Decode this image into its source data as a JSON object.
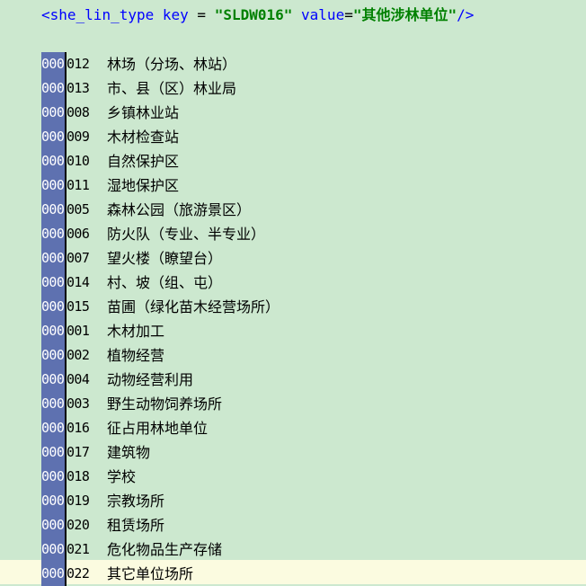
{
  "header": {
    "open_bracket": "<",
    "tag": "she_lin_type",
    "key_attr": "key",
    "key_eq": " = ",
    "key_value": "\"SLDW016\"",
    "value_attr": "value",
    "value_eq": "=",
    "value_value": "\"其他涉林单位\"",
    "close": "/>"
  },
  "items": [
    {
      "prefix": "000",
      "suffix": "012",
      "name": "林场（分场、林站）"
    },
    {
      "prefix": "000",
      "suffix": "013",
      "name": "市、县（区）林业局"
    },
    {
      "prefix": "000",
      "suffix": "008",
      "name": "乡镇林业站"
    },
    {
      "prefix": "000",
      "suffix": "009",
      "name": "木材检查站"
    },
    {
      "prefix": "000",
      "suffix": "010",
      "name": "自然保护区"
    },
    {
      "prefix": "000",
      "suffix": "011",
      "name": "湿地保护区"
    },
    {
      "prefix": "000",
      "suffix": "005",
      "name": "森林公园（旅游景区）"
    },
    {
      "prefix": "000",
      "suffix": "006",
      "name": "防火队（专业、半专业）"
    },
    {
      "prefix": "000",
      "suffix": "007",
      "name": "望火楼（瞭望台）"
    },
    {
      "prefix": "000",
      "suffix": "014",
      "name": "村、坡（组、屯）"
    },
    {
      "prefix": "000",
      "suffix": "015",
      "name": "苗圃（绿化苗木经营场所）"
    },
    {
      "prefix": "000",
      "suffix": "001",
      "name": "木材加工"
    },
    {
      "prefix": "000",
      "suffix": "002",
      "name": "植物经营"
    },
    {
      "prefix": "000",
      "suffix": "004",
      "name": "动物经营利用"
    },
    {
      "prefix": "000",
      "suffix": "003",
      "name": "野生动物饲养场所"
    },
    {
      "prefix": "000",
      "suffix": "016",
      "name": "征占用林地单位"
    },
    {
      "prefix": "000",
      "suffix": "017",
      "name": "建筑物"
    },
    {
      "prefix": "000",
      "suffix": "018",
      "name": "学校"
    },
    {
      "prefix": "000",
      "suffix": "019",
      "name": "宗教场所"
    },
    {
      "prefix": "000",
      "suffix": "020",
      "name": "租赁场所"
    },
    {
      "prefix": "000",
      "suffix": "021",
      "name": "危化物品生产存储"
    },
    {
      "prefix": "000",
      "suffix": "022",
      "name": "其它单位场所"
    }
  ],
  "colors": {
    "editor_background": "#cce8cf",
    "selection": "#5e71b0",
    "current_line": "#fbfbe0",
    "xml_tag": "#0000ff",
    "xml_value": "#008000"
  }
}
